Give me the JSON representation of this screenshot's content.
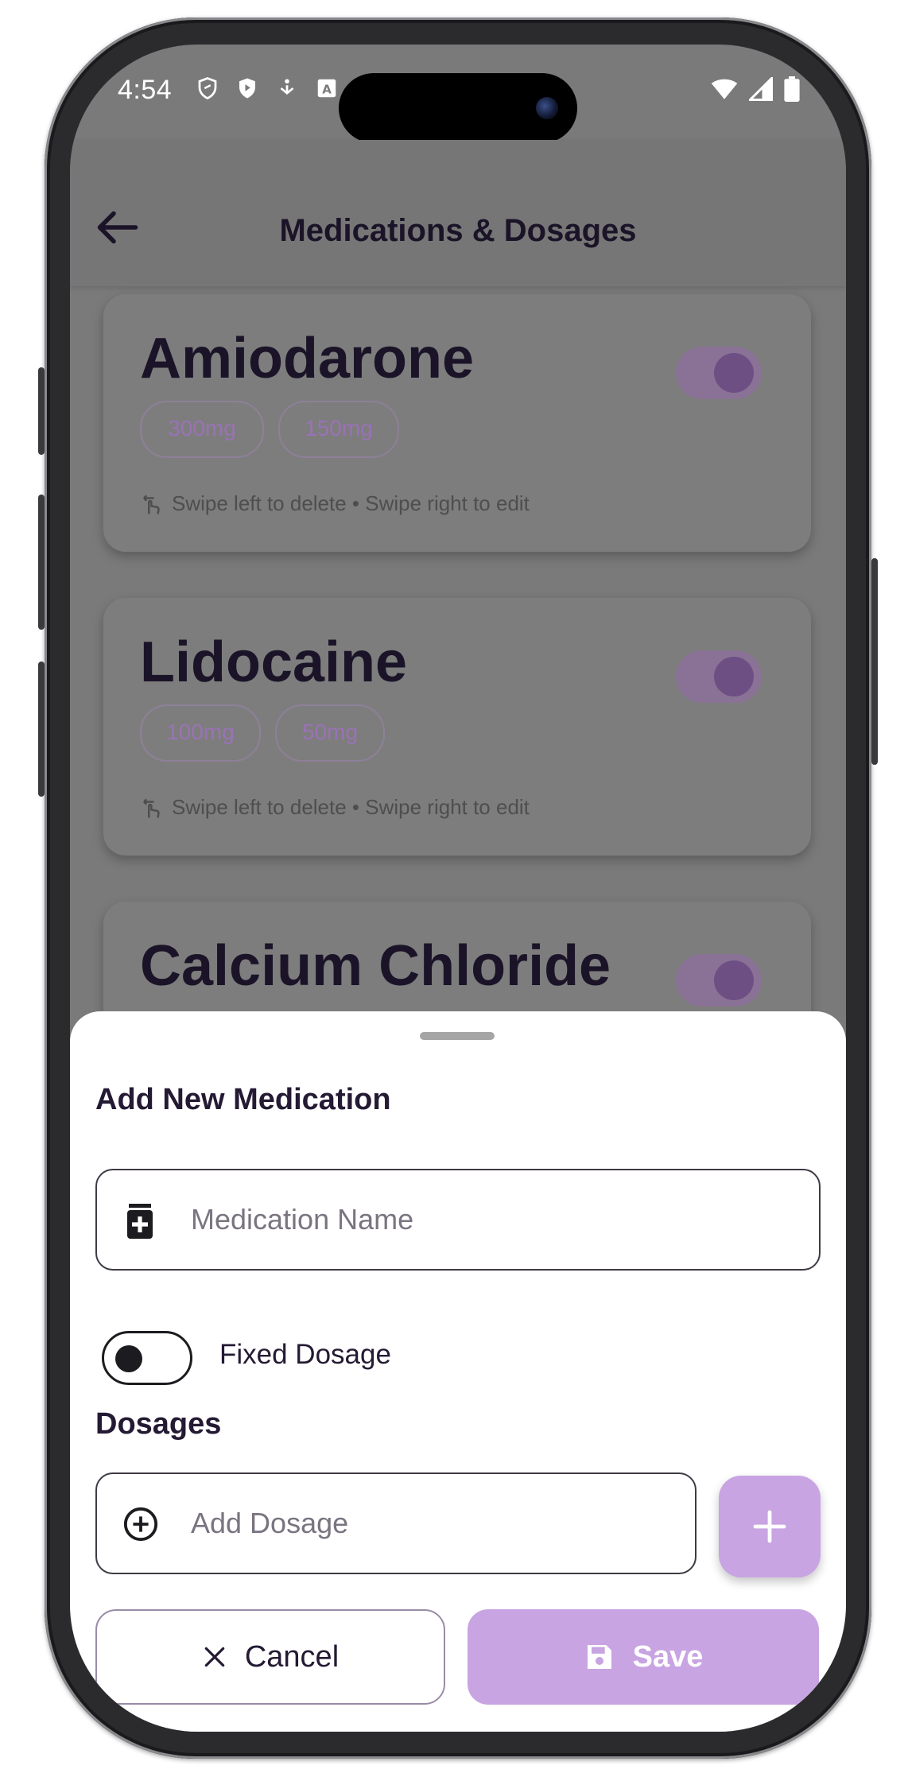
{
  "status_bar": {
    "time": "4:54"
  },
  "app_bar": {
    "title": "Medications & Dosages"
  },
  "medications": [
    {
      "name": "Amiodarone",
      "dosages": [
        "300mg",
        "150mg"
      ],
      "enabled": true,
      "hint": "Swipe left to delete • Swipe right to edit"
    },
    {
      "name": "Lidocaine",
      "dosages": [
        "100mg",
        "50mg"
      ],
      "enabled": true,
      "hint": "Swipe left to delete • Swipe right to edit"
    },
    {
      "name": "Calcium Chloride",
      "enabled": true
    }
  ],
  "sheet": {
    "title": "Add New Medication",
    "name_placeholder": "Medication Name",
    "fixed_dosage_label": "Fixed Dosage",
    "fixed_dosage_on": false,
    "dosages_heading": "Dosages",
    "dosage_placeholder": "Add Dosage",
    "cancel_label": "Cancel",
    "save_label": "Save"
  },
  "colors": {
    "accent": "#c8a4e2",
    "text_dark": "#241a33",
    "scrim": "#7a7a7a"
  },
  "icons": [
    "back-arrow-icon",
    "medication-bottle-icon",
    "add-circle-icon",
    "plus-icon",
    "close-icon",
    "save-disk-icon",
    "swipe-hand-icon",
    "wifi-icon",
    "signal-icon",
    "battery-icon"
  ]
}
